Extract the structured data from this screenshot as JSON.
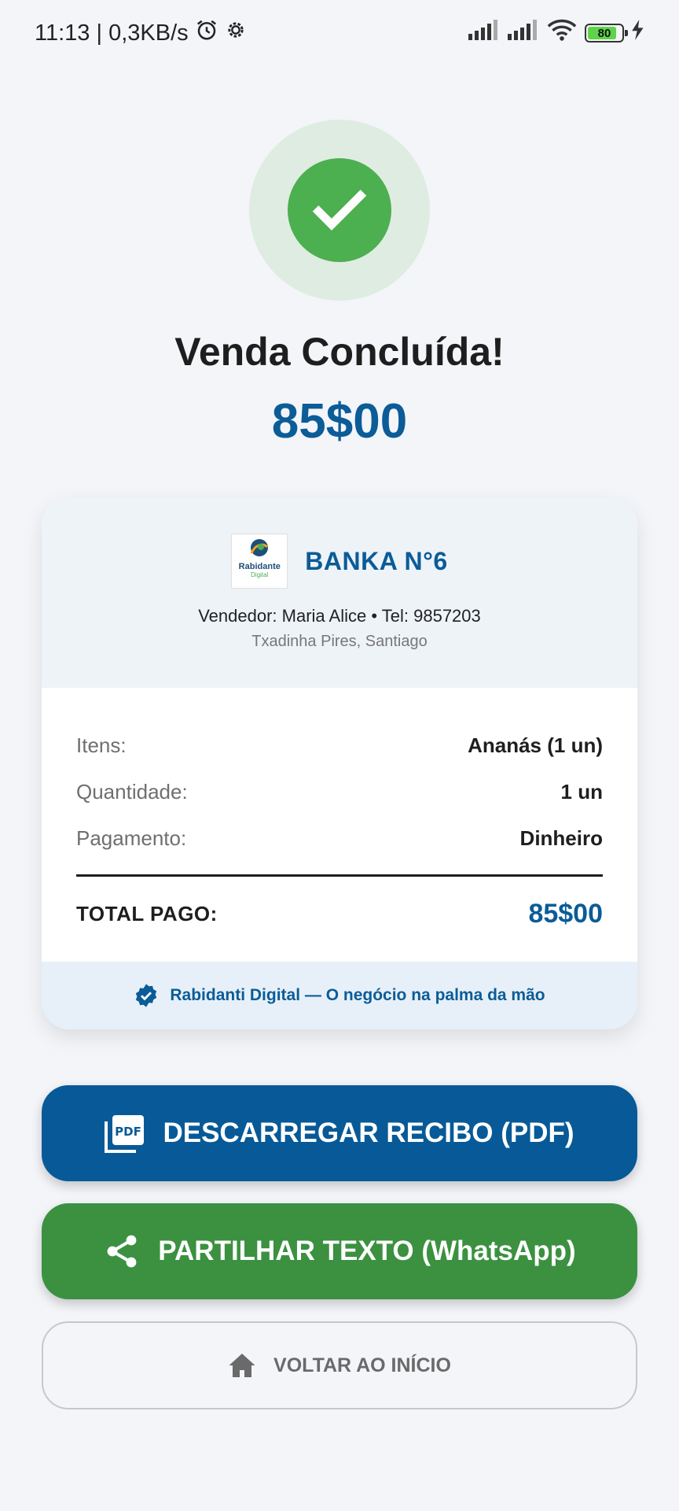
{
  "status_bar": {
    "time_info": "11:13 | 0,3KB/s",
    "battery": "80"
  },
  "success": {
    "title": "Venda Concluída!",
    "amount": "85$00"
  },
  "receipt": {
    "logo_name": "Rabidante",
    "logo_sub": "Digital",
    "store_name": "BANKA N°6",
    "vendor": "Vendedor: Maria Alice • Tel: 9857203",
    "location": "Txadinha Pires, Santiago",
    "rows": [
      {
        "label": "Itens:",
        "value": "Ananás (1 un)"
      },
      {
        "label": "Quantidade:",
        "value": "1 un"
      },
      {
        "label": "Pagamento:",
        "value": "Dinheiro"
      }
    ],
    "total_label": "TOTAL PAGO:",
    "total_value": "85$00",
    "footer": "Rabidanti Digital — O negócio na palma da mão"
  },
  "actions": {
    "pdf_label": "DESCARREGAR RECIBO (PDF)",
    "share_label": "PARTILHAR TEXTO (WhatsApp)",
    "home_label": "VOLTAR AO INÍCIO"
  },
  "colors": {
    "primary_blue": "#0b5c97",
    "success_green": "#4caf50",
    "share_green": "#3b9140"
  },
  "icons": [
    "alarm-icon",
    "settings-icon",
    "signal-icon",
    "wifi-icon",
    "battery-icon",
    "charging-icon",
    "check-icon",
    "verified-badge-icon",
    "pdf-icon",
    "share-icon",
    "home-icon"
  ]
}
